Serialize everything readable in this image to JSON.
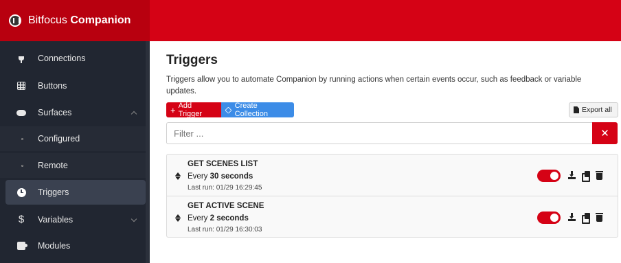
{
  "app": {
    "brand_prefix": "Bitfocus",
    "brand_name": "Companion"
  },
  "sidebar": {
    "items": [
      {
        "label": "Connections",
        "icon": "plug-icon"
      },
      {
        "label": "Buttons",
        "icon": "grid-icon"
      },
      {
        "label": "Surfaces",
        "icon": "gamepad-icon",
        "expanded": true
      },
      {
        "label": "Configured",
        "icon": "bullet-icon"
      },
      {
        "label": "Remote",
        "icon": "bullet-icon"
      },
      {
        "label": "Triggers",
        "icon": "clock-icon",
        "active": true
      },
      {
        "label": "Variables",
        "icon": "dollar-icon",
        "expanded": false
      },
      {
        "label": "Modules",
        "icon": "puzzle-icon"
      }
    ]
  },
  "main": {
    "title": "Triggers",
    "description": "Triggers allow you to automate Companion by running actions when certain events occur, such as feedback or variable updates.",
    "add_trigger_label": "Add Trigger",
    "create_collection_label": "Create Collection",
    "export_all_label": "Export all",
    "filter_placeholder": "Filter ...",
    "triggers": [
      {
        "name": "GET SCENES LIST",
        "freq_prefix": "Every",
        "freq_value": "30 seconds",
        "last_run": "Last run: 01/29 16:29:45",
        "enabled": true
      },
      {
        "name": "GET ACTIVE SCENE",
        "freq_prefix": "Every",
        "freq_value": "2 seconds",
        "last_run": "Last run: 01/29 16:30:03",
        "enabled": true
      }
    ]
  },
  "colors": {
    "brand_red": "#d50215",
    "sidebar_bg": "#212631",
    "collection_blue": "#3c8ce7"
  }
}
